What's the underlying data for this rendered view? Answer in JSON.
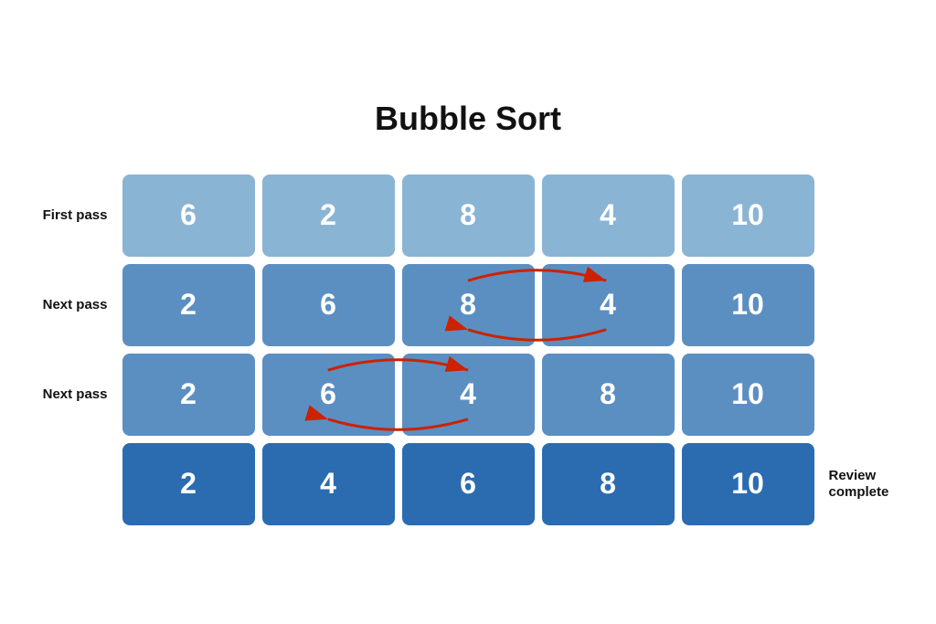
{
  "title": "Bubble Sort",
  "rows": [
    {
      "label": "First pass",
      "labelSide": "left",
      "cells": [
        6,
        2,
        8,
        4,
        10
      ],
      "colorClass": "cell-light",
      "hasArrow": false
    },
    {
      "label": "Next pass",
      "labelSide": "left",
      "cells": [
        2,
        6,
        8,
        4,
        10
      ],
      "colorClass": "cell-medium",
      "hasArrow": true,
      "arrowType": "row2"
    },
    {
      "label": "Next pass",
      "labelSide": "left",
      "cells": [
        2,
        6,
        4,
        8,
        10
      ],
      "colorClass": "cell-medium",
      "hasArrow": true,
      "arrowType": "row3"
    },
    {
      "label": "Review complete",
      "labelSide": "right",
      "cells": [
        2,
        4,
        6,
        8,
        10
      ],
      "colorClass": "cell-dark",
      "hasArrow": false
    }
  ]
}
